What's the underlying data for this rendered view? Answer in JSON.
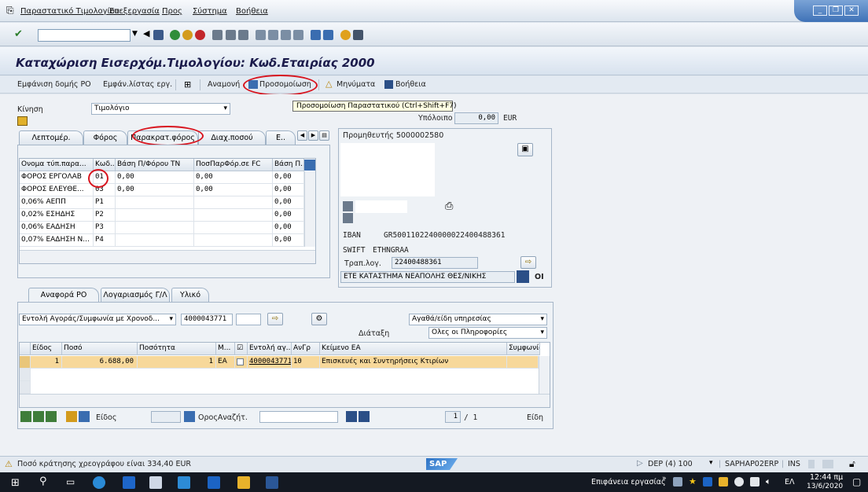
{
  "menu": {
    "items": [
      "Παραστατικό Τιμολογίου",
      "Επεξεργασία",
      "Προς",
      "Σύστημα",
      "Βοήθεια"
    ]
  },
  "window": {
    "title": "Καταχώριση Εισερχόμ.Τιμολογίου: Κωδ.Εταιρίας 2000"
  },
  "apptoolbar": {
    "po_structure": "Εμφάνιση δομής PO",
    "worklist": "Εμφάν.λίστας εργ.",
    "hold": "Αναμονή",
    "simulate": "Προσομοίωση",
    "messages": "Μηνύματα",
    "help": "Βοήθεια"
  },
  "tooltip": "Προσομοίωση Παραστατικού   (Ctrl+Shift+F7)",
  "header": {
    "kinisi_label": "Κίνηση",
    "kinisi_value": "Τιμολόγιο",
    "amount": "0,00",
    "currency": "EUR",
    "balance_label": "Υπόλοιπο"
  },
  "tabs": [
    "Λεπτομέρ.",
    "Φόρος",
    "Παρακρατ.φόρος",
    "Διαχ.ποσού",
    "Ε.."
  ],
  "wht_table": {
    "headers": [
      "Ονομα τύπ.παρα...",
      "Κωδ...",
      "Βάση Π/Φόρου ΤΝ",
      "ΠοσΠαρΦόρ.σε FC",
      "Βάση Π..."
    ],
    "rows": [
      [
        "ΦΟΡΟΣ ΕΡΓΟΛΑΒ",
        "01",
        "0,00",
        "0,00",
        "0,00"
      ],
      [
        "ΦΟΡΟΣ ΕΛΕΥΘΕ...",
        "03",
        "0,00",
        "0,00",
        "0,00"
      ],
      [
        "0,06% ΑΕΠΠ",
        "P1",
        "",
        "",
        "0,00"
      ],
      [
        "0,02% ΕΣΗΔΗΣ",
        "P2",
        "",
        "",
        "0,00"
      ],
      [
        "0,06% ΕΑΔΗΣΗ",
        "P3",
        "",
        "",
        "0,00"
      ],
      [
        "0,07% ΕΑΔΗΣΗ Ν...",
        "P4",
        "",
        "",
        "0,00"
      ]
    ]
  },
  "vendor": {
    "title": "Προμηθευτής 5000002580",
    "iban_label": "IBAN",
    "iban": "GR5001102240000022400488361",
    "swift_label": "SWIFT",
    "swift": "ETHNGRAA",
    "bank_acc_label": "Τραπ.λογ.",
    "bank_acc": "22400488361",
    "bank_name": "ΕΤΕ ΚΑΤΑΣΤΗΜΑ ΝΕΑΠΟΛΗΣ ΘΕΣ/ΝΙΚΗΣ",
    "oi": "OI"
  },
  "bottom_tabs": [
    "Αναφορά PO",
    "Λογαριασμός Γ/Λ",
    "Υλικό"
  ],
  "po_ref": {
    "doc_type": "Εντολή Αγοράς/Συμφωνία με Χρονοδ...",
    "po_number": "4000043771",
    "goods_type": "Αγαθά/είδη υπηρεσίας",
    "layout_label": "Διάταξη",
    "layout_value": "Ολες οι Πληροφορίες"
  },
  "items_table": {
    "headers": [
      "Είδος",
      "Ποσό",
      "Ποσότητα",
      "Μ...",
      "",
      "Εντολή αγ...",
      "ΑνΓρ",
      "Κείμενο ΕΑ",
      "Συμφωνία"
    ],
    "row": [
      "1",
      "6.688,00",
      "1",
      "EA",
      "",
      "4000043771",
      "10",
      "Επισκευές και Συντηρήσεις Κτιρίων",
      ""
    ]
  },
  "items_footer": {
    "item_label": "Είδος",
    "search_label": "ΟροςΑναζήτ.",
    "page": "1",
    "page_total": "/ 1",
    "items_label": "Είδη"
  },
  "status": {
    "message": "Ποσό κράτησης χρεογράφου είναι 334,40 EUR",
    "sap": "SAP",
    "system": "DEP (4) 100",
    "server": "SAPHAP02ERP",
    "mode": "INS"
  },
  "taskbar": {
    "desktop": "Επιφάνεια εργασίας",
    "lang": "ΕΛ",
    "time": "12:44 πμ",
    "date": "13/6/2020"
  },
  "colors": {
    "accent": "#d8141e",
    "selected_row": "#f7d89a",
    "title": "#1b1b4b"
  }
}
